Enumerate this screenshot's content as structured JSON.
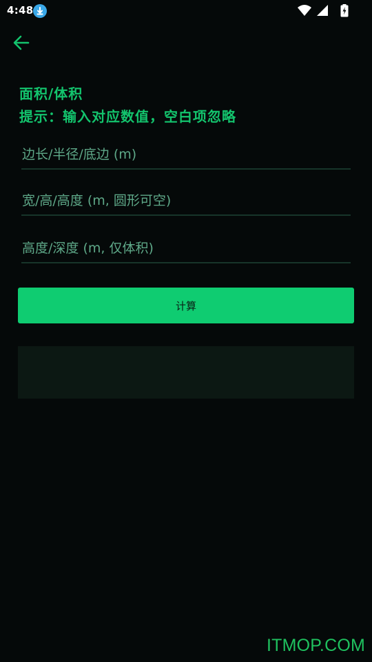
{
  "status_bar": {
    "time": "4:48",
    "icons": [
      "download-icon",
      "wifi-icon",
      "signal-icon",
      "battery-charging-icon"
    ]
  },
  "toolbar": {
    "back_icon": "arrow-left-icon"
  },
  "header": {
    "title": "面积/体积",
    "hint": "提示：输入对应数值，空白项忽略"
  },
  "form": {
    "fields": [
      {
        "placeholder": "边长/半径/底边 (m)",
        "value": ""
      },
      {
        "placeholder": "宽/高/高度 (m, 圆形可空)",
        "value": ""
      },
      {
        "placeholder": "高度/深度 (m, 仅体积)",
        "value": ""
      }
    ],
    "calculate_label": "计算"
  },
  "result": {
    "text": ""
  },
  "watermark": "ITMOP.COM",
  "colors": {
    "background": "#050909",
    "accent": "#13c46d",
    "button": "#0fcc71",
    "placeholder": "#5ea888",
    "result_bg": "#0c1813"
  }
}
